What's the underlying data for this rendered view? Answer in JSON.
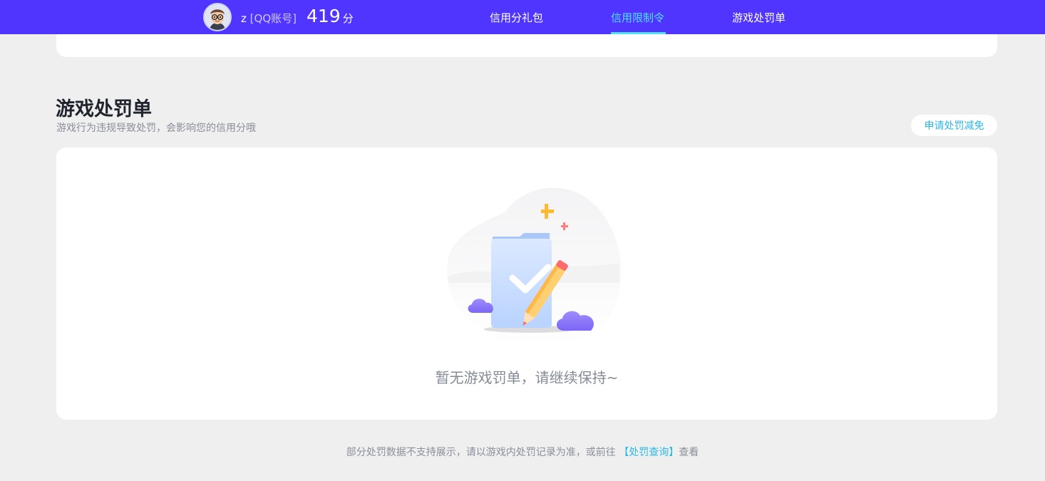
{
  "header": {
    "user_name": "z",
    "account_type": "[QQ账号]",
    "score": "419",
    "score_unit": "分",
    "nav": [
      {
        "label": "信用分礼包",
        "active": false
      },
      {
        "label": "信用限制令",
        "active": true
      },
      {
        "label": "游戏处罚单",
        "active": false
      }
    ]
  },
  "section": {
    "title": "游戏处罚单",
    "subtitle": "游戏行为违规导致处罚，会影响您的信用分哦",
    "appeal_label": "申请处罚减免"
  },
  "empty_state": {
    "message": "暂无游戏罚单，请继续保持~"
  },
  "footer": {
    "prefix": "部分处罚数据不支持展示，请以游戏内处罚记录为准，或前往 ",
    "link": "【处罚查询】",
    "suffix": "查看"
  },
  "colors": {
    "header_bg": "#5034ff",
    "active_nav": "#4fe0ff",
    "link": "#2cb8e6",
    "page_bg": "#efefef"
  }
}
